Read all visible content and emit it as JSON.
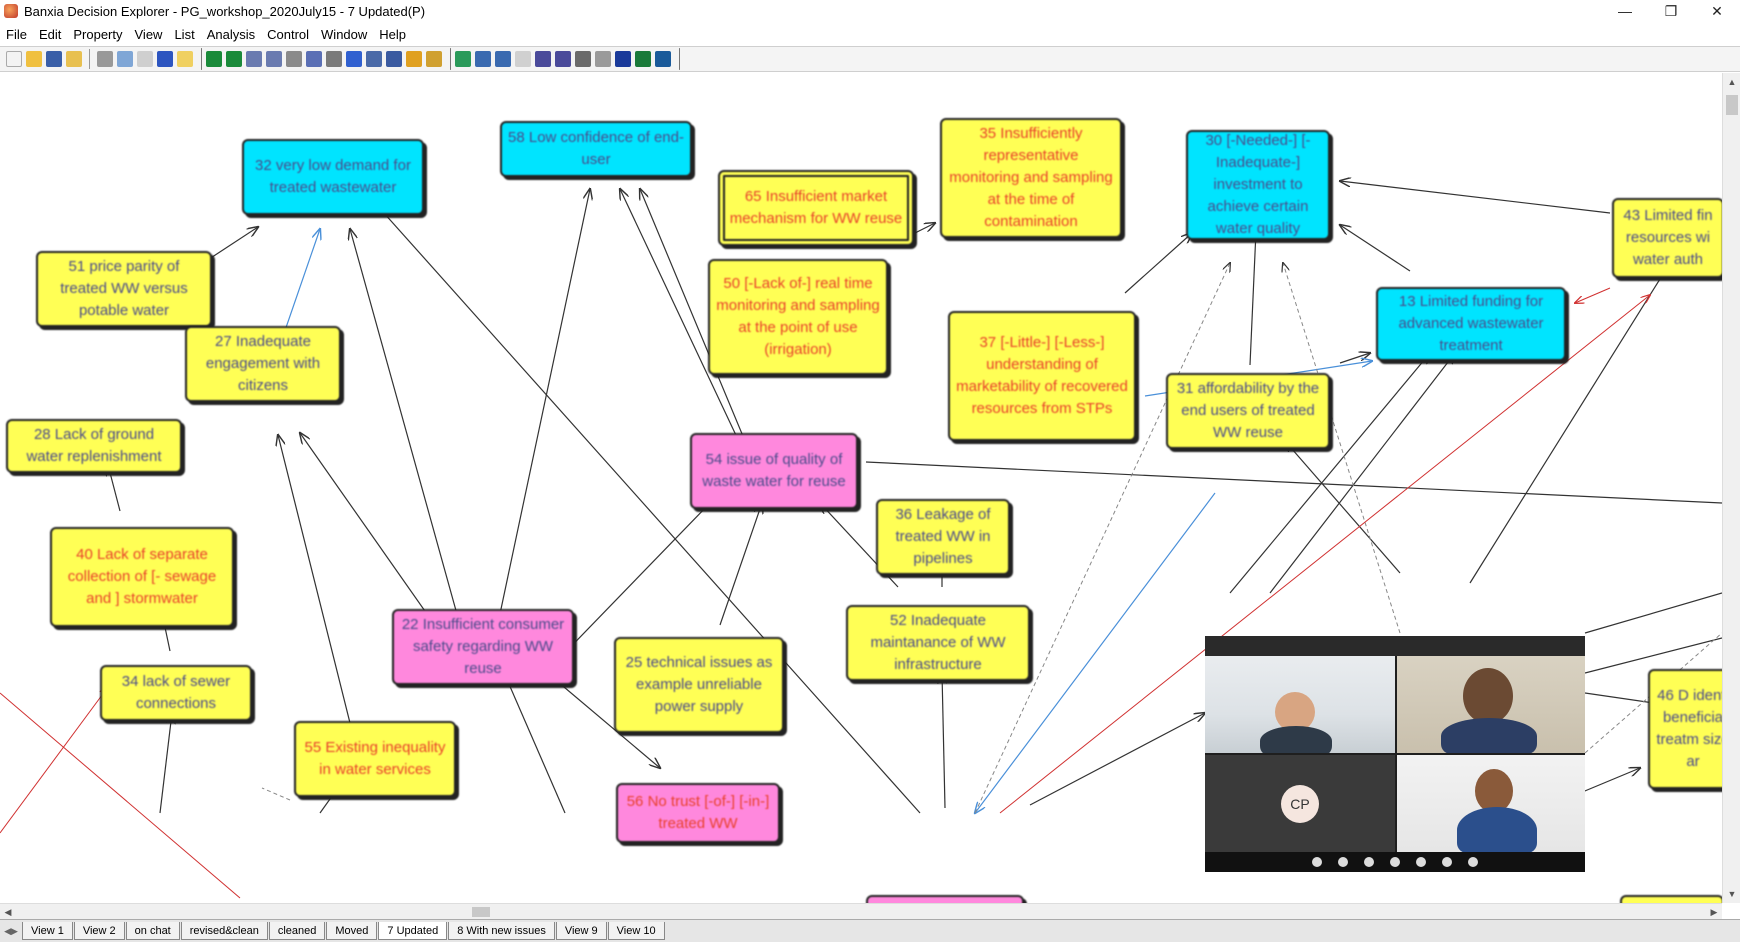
{
  "window": {
    "title": "Banxia Decision Explorer - PG_workshop_2020July15 - 7 Updated(P)",
    "controls": [
      "—",
      "❐",
      "✕"
    ]
  },
  "menu": [
    "File",
    "Edit",
    "Property",
    "View",
    "List",
    "Analysis",
    "Control",
    "Window",
    "Help"
  ],
  "nodes": {
    "n32": "32 very low demand for treated wastewater",
    "n58": "58 Low confidence of end-user",
    "n65": "65 Insufficient market mechanism for WW reuse",
    "n35": "35 Insufficiently representative monitoring and sampling at the time of contamination",
    "n30": "30 [-Needed-] [-Inadequate-] investment to achieve certain water quality",
    "n43": "43 Limited fin resources wi water auth",
    "n51": "51 price parity of treated WW versus potable water",
    "n27": "27 Inadequate engagement with citizens",
    "n50": "50 [-Lack of-] real time monitoring and sampling at the point of use (irrigation)",
    "n37": "37 [-Little-] [-Less-] understanding of marketability of recovered resources from STPs",
    "n13": "13 Limited funding for advanced wastewater treatment",
    "n31": "31 affordability by the end users of treated WW reuse",
    "n28": "28 Lack of ground water replenishment",
    "n54": "54 issue of quality of waste water for reuse",
    "n36": "36 Leakage of treated WW in pipelines",
    "n40": "40 Lack of separate collection of [- sewage and ] stormwater",
    "n22": "22 Insufficient consumer safety regarding WW reuse",
    "n25": "25 technical issues as example unreliable power supply",
    "n52": "52 Inadequate maintanance of WW infrastructure",
    "n34": "34 lack of sewer connections",
    "n55": "55 Existing inequality in water services",
    "n56": "56 No trust [-of-] [-in-] treated WW",
    "n46": "46 D identi beneficia treatm size ar"
  },
  "tabs": [
    "View 1",
    "View 2",
    "on chat",
    "revised&clean",
    "cleaned",
    "Moved",
    "7 Updated",
    "8 With new issues",
    "View 9",
    "View 10"
  ],
  "call": {
    "avatar_initials": "CP"
  }
}
